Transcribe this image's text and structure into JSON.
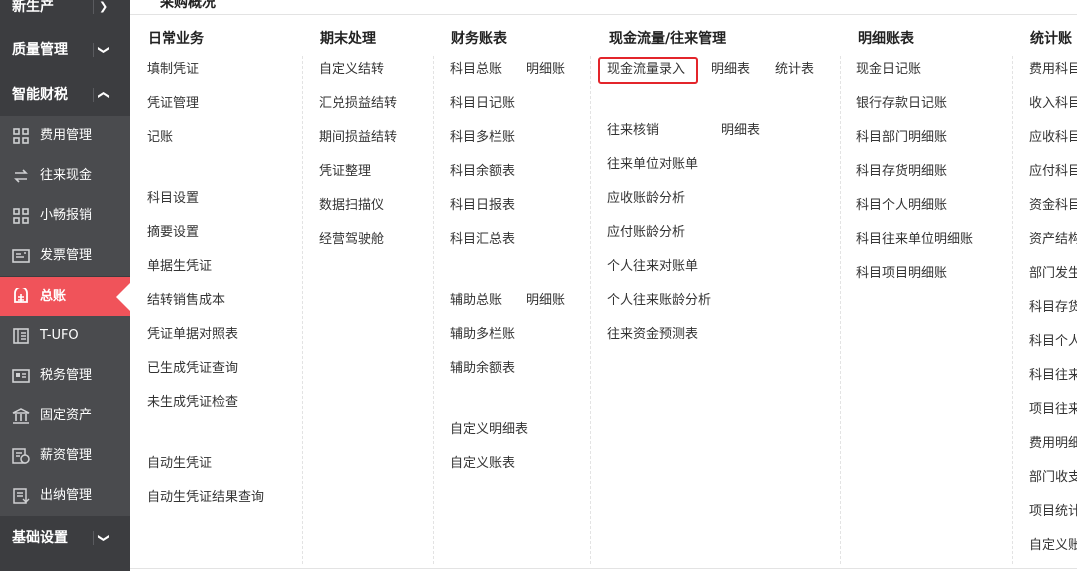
{
  "top_title": "采购概况",
  "sidebar": {
    "headers": [
      {
        "label": "新生产",
        "chevron": "down"
      },
      {
        "label": "质量管理",
        "chevron": "down"
      },
      {
        "label": "智能财税",
        "chevron": "up"
      },
      {
        "label": "基础设置",
        "chevron": "down"
      }
    ],
    "items": [
      {
        "label": "费用管理",
        "icon": "grid-icon"
      },
      {
        "label": "往来现金",
        "icon": "transfer-icon"
      },
      {
        "label": "小畅报销",
        "icon": "grid-icon"
      },
      {
        "label": "发票管理",
        "icon": "invoice-icon"
      },
      {
        "label": "总账",
        "icon": "ledger-icon",
        "active": true
      },
      {
        "label": "T-UFO",
        "icon": "book-icon"
      },
      {
        "label": "税务管理",
        "icon": "card-icon"
      },
      {
        "label": "固定资产",
        "icon": "bank-icon"
      },
      {
        "label": "薪资管理",
        "icon": "salary-icon"
      },
      {
        "label": "出纳管理",
        "icon": "cashier-icon"
      }
    ]
  },
  "columns": {
    "daily": {
      "title": "日常业务",
      "items": [
        "填制凭证",
        "凭证管理",
        "记账",
        "科目设置",
        "摘要设置",
        "单据生凭证",
        "结转销售成本",
        "凭证单据对照表",
        "已生成凭证查询",
        "未生成凭证检查",
        "自动生凭证",
        "自动生凭证结果查询"
      ]
    },
    "period_end": {
      "title": "期末处理",
      "items": [
        "自定义结转",
        "汇兑损益结转",
        "期间损益结转",
        "凭证整理",
        "数据扫描仪",
        "经营驾驶舱"
      ]
    },
    "financial": {
      "title": "财务账表",
      "items": [
        "科目总账",
        "明细账",
        "科目日记账",
        "科目多栏账",
        "科目余额表",
        "科目日报表",
        "科目汇总表",
        "辅助总账",
        "明细账",
        "辅助多栏账",
        "辅助余额表",
        "自定义明细表",
        "自定义账表"
      ]
    },
    "cashflow": {
      "title": "现金流量/往来管理",
      "items": [
        "现金流量录入",
        "明细表",
        "统计表",
        "往来核销",
        "明细表",
        "往来单位对账单",
        "应收账龄分析",
        "应付账龄分析",
        "个人往来对账单",
        "个人往来账龄分析",
        "往来资金预测表"
      ]
    },
    "detail": {
      "title": "明细账表",
      "items": [
        "现金日记账",
        "银行存款日记账",
        "科目部门明细账",
        "科目存货明细账",
        "科目个人明细账",
        "科目往来单位明细账",
        "科目项目明细账"
      ]
    },
    "stats": {
      "title": "统计账",
      "items": [
        "费用科目",
        "收入科目",
        "应收科目",
        "应付科目",
        "资金科目",
        "资产结构",
        "部门发生",
        "科目存货",
        "科目个人",
        "科目往来",
        "项目往来",
        "费用明细",
        "部门收支",
        "项目统计",
        "自定义账"
      ]
    }
  }
}
